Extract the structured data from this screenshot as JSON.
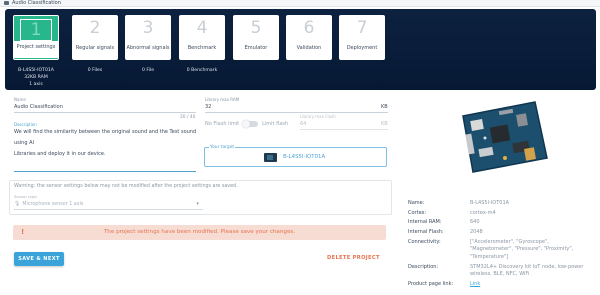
{
  "window": {
    "title": "Audio Classification"
  },
  "steps": [
    {
      "num": "1",
      "label": "Project settings"
    },
    {
      "num": "2",
      "label": "Regular signals"
    },
    {
      "num": "3",
      "label": "Abnormal signals"
    },
    {
      "num": "4",
      "label": "Benchmark"
    },
    {
      "num": "5",
      "label": "Emulator"
    },
    {
      "num": "6",
      "label": "Validation"
    },
    {
      "num": "7",
      "label": "Deployment"
    }
  ],
  "step_info": {
    "board": "B-L4S5I-IOT01A",
    "ram": "32KB RAM",
    "axis": "1 axis",
    "regular": "0 Files",
    "abnormal": "0 File",
    "benchmark": "0 Benchmark"
  },
  "form": {
    "name_label": "Name",
    "name_value": "Audio Classification",
    "name_counter": "20 / 40",
    "ram_label": "Library max RAM",
    "ram_value": "32",
    "ram_unit": "KB",
    "noflash_label": "No Flash limit",
    "limitflash_label": "Limit flash",
    "flash_label": "Library max Flash",
    "flash_value": "64",
    "flash_unit": "KB",
    "desc_label": "Description",
    "desc_text_1": "We will find the similarity between the original sound and the Test sound using AI",
    "desc_text_2": "Libraries and deploy it in our device.",
    "target_label": "Your target",
    "target_name": "B-L4S5I-IOT01A"
  },
  "sensor": {
    "warning": "Warning: the sensor settings below may not be modified after the project settings are saved.",
    "type_label": "Sensor type",
    "type_value": "Microphone sensor 1 axis"
  },
  "alert": {
    "icon": "!",
    "text": "The project settings have been modified. Please save your changes."
  },
  "actions": {
    "save": "SAVE & NEXT",
    "delete": "DELETE PROJECT"
  },
  "specs": [
    {
      "k": "Name:",
      "v": "B-L4S5I-IOT01A"
    },
    {
      "k": "Cortex:",
      "v": "cortex-m4"
    },
    {
      "k": "Internal RAM:",
      "v": "640"
    },
    {
      "k": "Internal Flash:",
      "v": "2048"
    },
    {
      "k": "Connectivity:",
      "v": "[\"Accelerometer\", \"Gyroscope\", \"Magnetometer\", \"Pressure\", \"Proximity\", \"Temperature\"]"
    },
    {
      "k": "Description:",
      "v": "STM32L4+ Discovery kit IoT node, low-power wireless, BLE, NFC, WiFi"
    },
    {
      "k": "Product page link:",
      "v": "Link"
    }
  ],
  "colors": {
    "accent": "#28b78c",
    "primary": "#3aa3da",
    "danger": "#e8744f",
    "banner": "#0b1f3d"
  }
}
